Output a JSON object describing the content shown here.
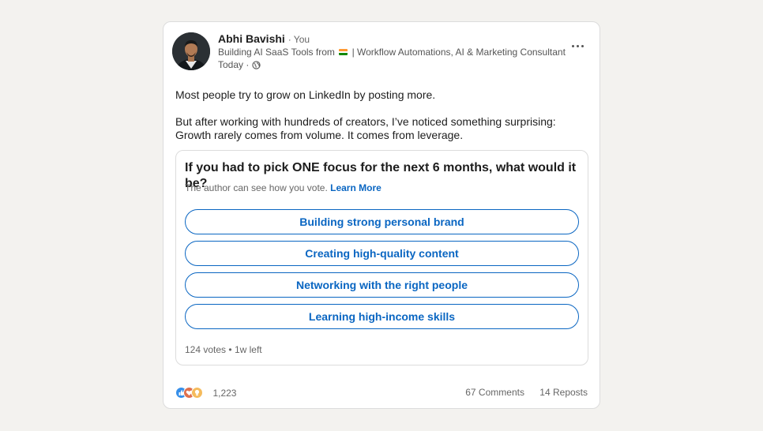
{
  "post": {
    "author": {
      "name": "Abhi Bavishi",
      "relation": "· You",
      "headline_before_flag": "Building AI SaaS Tools from",
      "headline_after_flag": "| Workflow Automations, AI & Marketing Consultant",
      "time": "Today ·"
    },
    "body": {
      "para1": "Most people try to grow on LinkedIn by posting more.",
      "para2": "But after working with hundreds of creators, I’ve noticed something surprising:",
      "para3": "Growth rarely comes from volume. It comes from leverage."
    },
    "poll": {
      "question": "If you had to pick ONE focus for the next 6 months, what would it be?",
      "note": "The author can see how you vote.",
      "learn_more": "Learn More",
      "options": [
        "Building strong personal brand",
        "Creating high-quality content",
        "Networking with the right people",
        "Learning high-income skills"
      ],
      "votes": "124 votes",
      "time_left": "1w left"
    },
    "social": {
      "reactions_count": "1,223",
      "comments": "67 Comments",
      "reposts": "14 Reposts"
    }
  },
  "icons": [
    "avatar",
    "india-flag-icon",
    "globe-icon",
    "more-options-icon",
    "like-reaction-icon",
    "love-reaction-icon",
    "insightful-reaction-icon"
  ],
  "colors": {
    "background": "#f3f2ef",
    "card": "#ffffff",
    "accent": "#0a66c2",
    "text": "#1d1d1d",
    "muted": "#666666"
  }
}
